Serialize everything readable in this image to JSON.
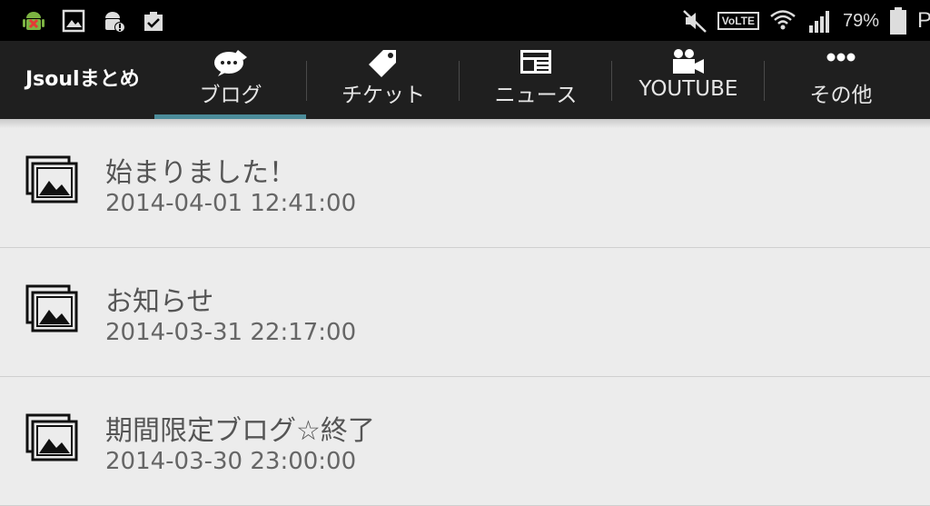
{
  "status_bar": {
    "left_icons": [
      "android-debug-icon",
      "image-notification-icon",
      "android-alert-icon",
      "clipboard-check-icon"
    ],
    "right": {
      "volte": "VoLTE",
      "battery_percent": "79%",
      "cut_text": "P"
    }
  },
  "app_bar": {
    "title": "Jsoulまとめ",
    "tabs": [
      {
        "label": "ブログ",
        "icon": "speech-bubble-icon",
        "selected": true
      },
      {
        "label": "チケット",
        "icon": "ticket-tag-icon",
        "selected": false
      },
      {
        "label": "ニュース",
        "icon": "newspaper-icon",
        "selected": false
      },
      {
        "label": "YOUTUBE",
        "icon": "video-camera-icon",
        "selected": false
      },
      {
        "label": "その他",
        "icon": "more-dots-icon",
        "selected": false
      }
    ],
    "accent_color": "#4c8c9a"
  },
  "list": {
    "items": [
      {
        "title": "始まりました！",
        "date": "2014-04-01 12:41:00",
        "icon": "image-stack-icon"
      },
      {
        "title": "お知らせ",
        "date": "2014-03-31 22:17:00",
        "icon": "image-stack-icon"
      },
      {
        "title": "期間限定ブログ☆終了",
        "date": "2014-03-30 23:00:00",
        "icon": "image-stack-icon"
      }
    ]
  }
}
